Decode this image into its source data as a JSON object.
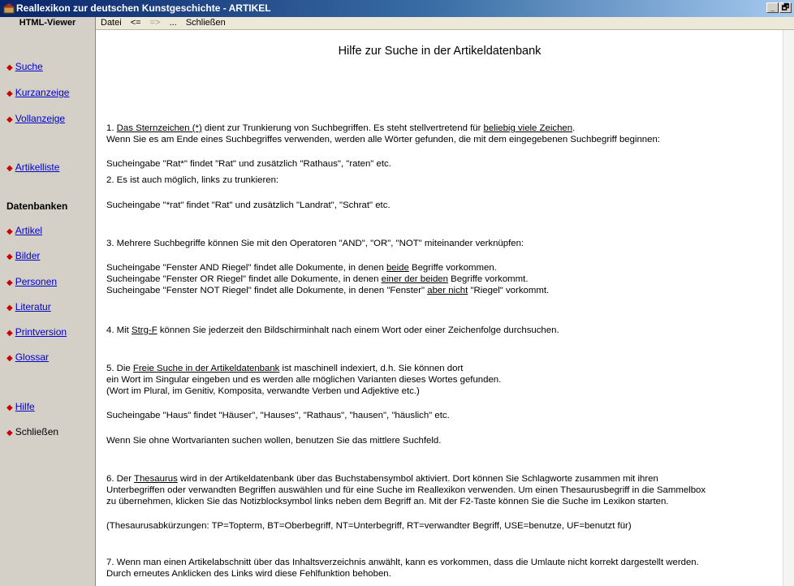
{
  "window": {
    "title": "Reallexikon zur deutschen Kunstgeschichte  - ARTIKEL",
    "minimize": "_",
    "restore": "🗗"
  },
  "viewer_tab": "HTML-Viewer",
  "menu": {
    "datei": "Datei",
    "back": "<=",
    "forward": "=>",
    "more": "...",
    "close": "Schließen"
  },
  "sidebar": {
    "suche": "Suche",
    "kurzanzeige": "Kurzanzeige",
    "vollanzeige": "Vollanzeige",
    "artikelliste": "Artikelliste",
    "datenbanken_heading": "Datenbanken",
    "artikel": "Artikel",
    "bilder": "Bilder",
    "personen": "Personen",
    "literatur": "Literatur",
    "printversion": "Printversion",
    "glossar": "Glossar",
    "hilfe": "Hilfe",
    "schliessen": "Schließen"
  },
  "content": {
    "heading": "Hilfe zur Suche in der Artikeldatenbank",
    "s1": {
      "a": "1. ",
      "b": "Das Sternzeichen (*)",
      "c": " dient zur Trunkierung von Suchbegriffen. Es steht stellvertretend für ",
      "d": "beliebig viele Zeichen",
      "e": ".",
      "line2": "Wenn Sie es am Ende eines Suchbegriffes verwenden, werden alle Wörter gefunden, die mit dem eingegebenen Suchbegriff beginnen:",
      "example": "Sucheingabe \"Rat*\" findet \"Rat\" und zusätzlich \"Rathaus\", \"raten\" etc."
    },
    "s2": {
      "line1": "2. Es ist auch möglich, links zu trunkieren:",
      "example": "Sucheingabe \"*rat\" findet \"Rat\" und zusätzlich \"Landrat\", \"Schrat\" etc."
    },
    "s3": {
      "line1": "3. Mehrere Suchbegriffe können Sie mit den Operatoren \"AND\", \"OR\", \"NOT\" miteinander verknüpfen:",
      "and_a": "Sucheingabe \"Fenster AND Riegel\" findet alle Dokumente, in denen ",
      "and_b": "beide",
      "and_c": " Begriffe vorkommen.",
      "or_a": "Sucheingabe \"Fenster OR Riegel\" findet alle Dokumente, in denen ",
      "or_b": "einer der beiden",
      "or_c": " Begriffe vorkommt.",
      "not_a": "Sucheingabe \"Fenster NOT Riegel\" findet alle Dokumente, in denen \"Fenster\" ",
      "not_b": "aber nicht",
      "not_c": " \"Riegel\" vorkommt."
    },
    "s4": {
      "a": "4. Mit ",
      "b": "Strg-F",
      "c": " können Sie jederzeit den Bildschirminhalt nach einem Wort oder einer Zeichenfolge durchsuchen."
    },
    "s5": {
      "a": "5. Die ",
      "b": "Freie Suche in der Artikeldatenbank",
      "c": " ist maschinell indexiert, d.h. Sie können dort",
      "line2": "ein Wort im Singular eingeben und es werden alle möglichen Varianten dieses Wortes gefunden.",
      "line3": "(Wort im Plural, im Genitiv, Komposita, verwandte Verben und Adjektive etc.)",
      "example": "Sucheingabe \"Haus\" findet \"Häuser\", \"Hauses\", \"Rathaus\", \"hausen\", \"häuslich\" etc.",
      "note": "Wenn Sie ohne Wortvarianten suchen wollen, benutzen Sie das mittlere Suchfeld."
    },
    "s6": {
      "a": "6. Der ",
      "b": "Thesaurus",
      "c": " wird in der Artikeldatenbank über das Buchstabensymbol aktiviert. Dort können Sie Schlagworte zusammen mit ihren",
      "line2": "Unterbegriffen oder verwandten Begriffen auswählen und für eine Suche im Reallexikon verwenden. Um einen Thesaurusbegriff in die Sammelbox",
      "line3": "zu übernehmen, klicken Sie das Notizblocksymbol links neben dem Begriff an. Mit der F2-Taste können Sie die Suche im Lexikon starten.",
      "abbr": "(Thesaurusabkürzungen: TP=Topterm, BT=Oberbegriff, NT=Unterbegriff, RT=verwandter Begriff, USE=benutze, UF=benutzt für)"
    },
    "s7": {
      "line1": "7. Wenn man einen Artikelabschnitt über das Inhaltsverzeichnis anwählt, kann es vorkommen, dass die Umlaute nicht korrekt dargestellt werden.",
      "line2": "Durch erneutes Anklicken des Links wird diese Fehlfunktion behoben."
    }
  },
  "icons": {
    "app": "app-icon",
    "bullet": "diamond-bullet-icon"
  },
  "colors": {
    "link": "#0000cc",
    "bullet": "#cc0000",
    "sidebar_bg": "#d4d0c8"
  }
}
